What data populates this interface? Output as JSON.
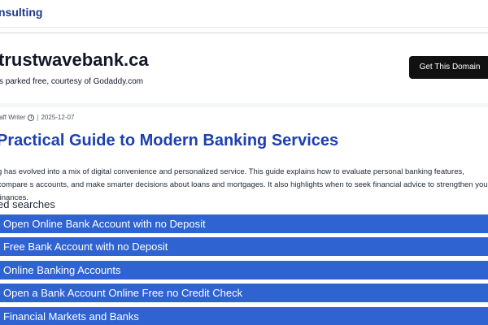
{
  "header": {
    "brand": "nsulting"
  },
  "banner": {
    "domain": "trustwavebank.ca",
    "note": "s parked free, courtesy of Godaddy.com",
    "button_label": "Get This Domain"
  },
  "article": {
    "author": "taff Writer",
    "date": "2025-12-07",
    "separator": "|",
    "title": "Practical Guide to Modern Banking Services",
    "intro": "g has evolved into a mix of digital convenience and personalized service. This guide explains how to evaluate personal banking features, compare s accounts, and make smarter decisions about loans and mortgages. It also highlights when to seek financial advice to strengthen your finances."
  },
  "related": {
    "heading": "ed searches",
    "items": [
      "Open Online Bank Account with no Deposit",
      "Free Bank Account with no Deposit",
      "Online Banking Accounts",
      "Open a Bank Account Online Free no Credit Check",
      "Financial Markets and Banks"
    ]
  },
  "colors": {
    "brand": "#1e3a8a",
    "title": "#1e40af",
    "related_button": "#2f63d1",
    "domain_button": "#111111"
  }
}
